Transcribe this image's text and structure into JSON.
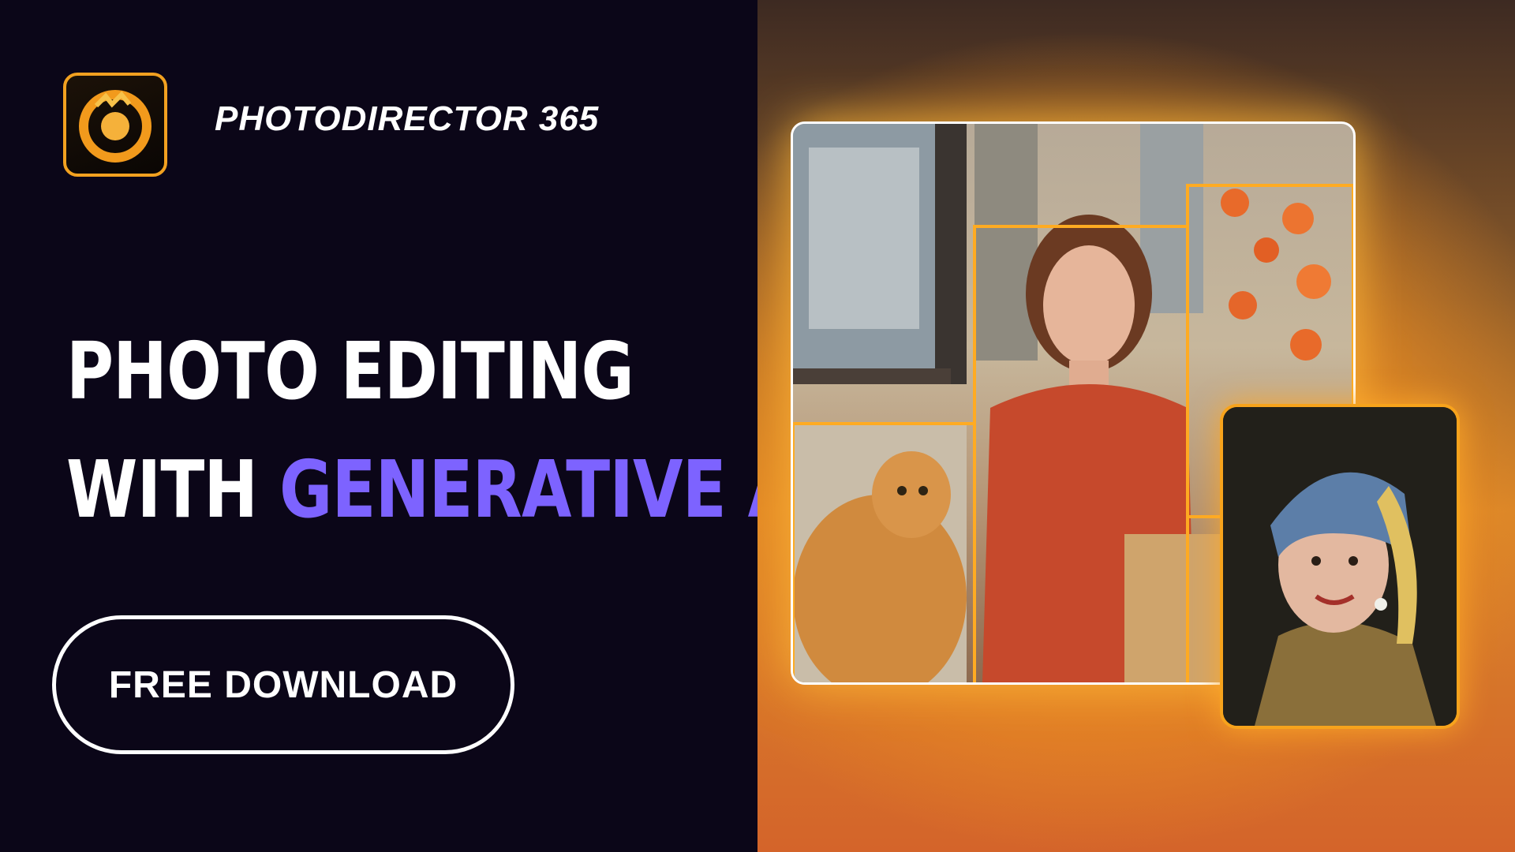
{
  "brand": {
    "app_name": "PHOTODIRECTOR 365",
    "icon": "photodirector-logo-icon"
  },
  "headline": {
    "line1": "PHOTO EDITING",
    "line2_prefix": "WITH ",
    "line2_accent": "GENERATIVE AI"
  },
  "cta": {
    "label": "FREE DOWNLOAD"
  },
  "colors": {
    "background": "#0b0618",
    "accent": "#7d63ff",
    "glow": "#f7a31c"
  }
}
